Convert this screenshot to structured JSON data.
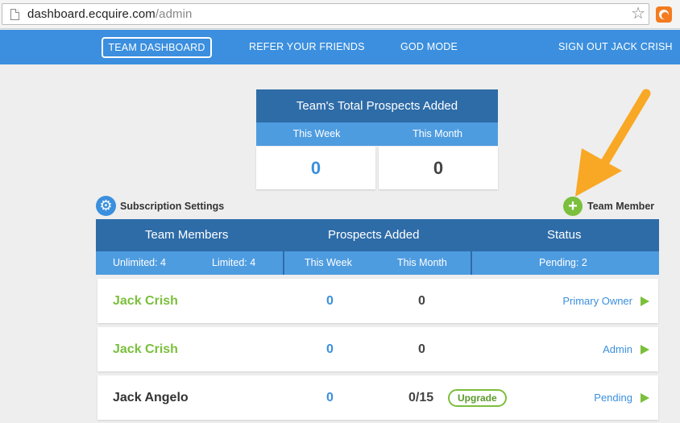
{
  "browser": {
    "url_host": "dashboard.ecquire.com",
    "url_path": "/admin"
  },
  "nav": {
    "items": [
      "TEAM DASHBOARD",
      "REFER YOUR FRIENDS",
      "GOD MODE",
      "SIGN OUT JACK CRISH"
    ],
    "active_index": 0
  },
  "totals": {
    "title": "Team's Total Prospects Added",
    "columns": [
      "This Week",
      "This Month"
    ],
    "values": [
      "0",
      "0"
    ]
  },
  "subscription": {
    "label": "Subscription Settings"
  },
  "add_member": {
    "label": "Team Member"
  },
  "team_table": {
    "headers": [
      "Team Members",
      "Prospects Added",
      "Status"
    ],
    "sub": {
      "unlimited": "Unlimited: 4",
      "limited": "Limited: 4",
      "this_week": "This Week",
      "this_month": "This Month",
      "pending": "Pending: 2"
    },
    "rows": [
      {
        "name": "Jack Crish",
        "week": "0",
        "month": "0",
        "status": "Primary Owner",
        "upgrade": ""
      },
      {
        "name": "Jack Crish",
        "week": "0",
        "month": "0",
        "status": "Admin",
        "upgrade": ""
      },
      {
        "name": "Jack Angelo",
        "week": "0",
        "month": "0/15",
        "status": "Pending",
        "upgrade": "Upgrade"
      }
    ]
  },
  "colors": {
    "brand_blue": "#3b8fde",
    "header_dark_blue": "#2e6ca8",
    "green": "#7bbf3c",
    "arrow_orange": "#f9a825"
  }
}
